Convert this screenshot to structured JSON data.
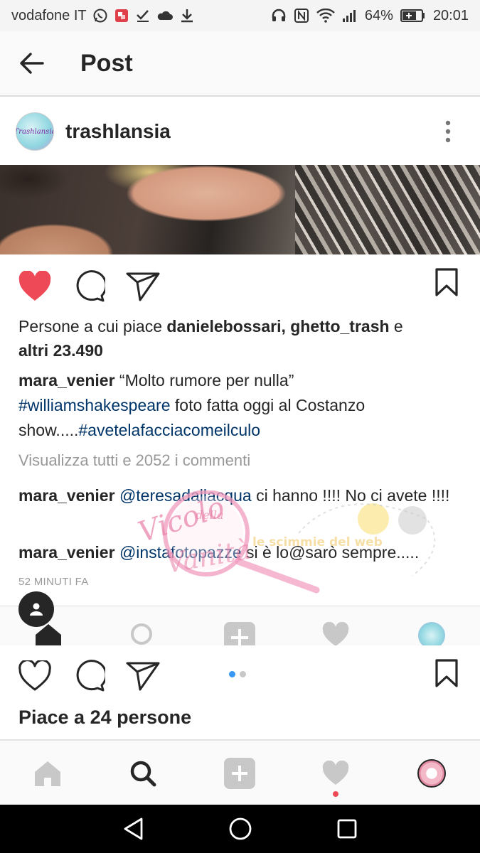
{
  "status_bar": {
    "carrier": "vodafone IT",
    "battery": "64%",
    "time": "20:01",
    "icons": [
      "whatsapp-icon",
      "app-notification-icon",
      "check-icon",
      "cloud-icon",
      "download-icon",
      "headphones-icon",
      "nfc-icon",
      "wifi-icon",
      "signal-icon",
      "battery-icon"
    ]
  },
  "header": {
    "title": "Post",
    "back_icon": "arrow-left-icon"
  },
  "post": {
    "username": "trashlansia",
    "avatar_text": "Trashlansia",
    "likes": {
      "prefix": "Persone a cui piace ",
      "users": "danielebossari, ghetto_trash",
      "connector": " e",
      "others": "altri 23.490"
    },
    "caption": {
      "author": "mara_venier",
      "text1": " “Molto rumore per nulla”",
      "hashtag1": "#williamshakespeare",
      "text2": "  foto fatta oggi al Costanzo show.....",
      "hashtag2": "#avetelafacciacomeilculo"
    },
    "view_comments": "Visualizza tutti e 2052 i commenti",
    "comments": [
      {
        "author": "mara_venier",
        "mention": "@teresadallacqua",
        "text": " ci hanno !!!! No ci avete !!!!"
      },
      {
        "author": "mara_venier",
        "mention": "@instafotopazze",
        "text": " si è lo@sarò sempre....."
      }
    ],
    "time": "52 MINUTI FA"
  },
  "watermark": {
    "text1": "Vicolo",
    "text2": "della",
    "text3": "Vanità",
    "text4": "le scimmie del web"
  },
  "second_post": {
    "likes": "Piace a 24 persone"
  },
  "colors": {
    "heart_red": "#ed4956",
    "link_blue": "#003569",
    "dot_blue": "#3897f0"
  }
}
